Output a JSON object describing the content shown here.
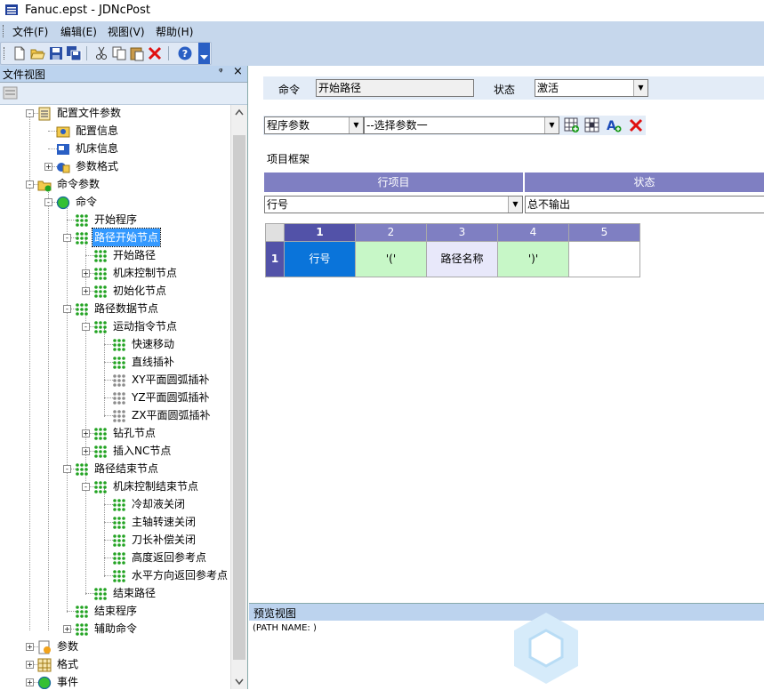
{
  "window": {
    "title": "Fanuc.epst - JDNcPost"
  },
  "menu": {
    "file": "文件(F)",
    "edit": "编辑(E)",
    "view": "视图(V)",
    "help": "帮助(H)"
  },
  "left_panel": {
    "title": "文件视图",
    "pin": "ᵠ",
    "close": "×"
  },
  "tree": [
    {
      "label": "配置文件参数",
      "icon": "config-file-icon"
    },
    {
      "label": "配置信息",
      "icon": "config-info-icon"
    },
    {
      "label": "机床信息",
      "icon": "machine-info-icon"
    },
    {
      "label": "参数格式",
      "icon": "param-format-icon"
    },
    {
      "label": "命令参数",
      "icon": "folder-icon"
    },
    {
      "label": "命令",
      "icon": "green-ball-icon"
    },
    {
      "label": "开始程序",
      "icon": "green-dots-icon"
    },
    {
      "label": "路径开始节点",
      "icon": "green-dots-icon",
      "selected": true
    },
    {
      "label": "开始路径",
      "icon": "green-dots-icon"
    },
    {
      "label": "机床控制节点",
      "icon": "green-dots-icon"
    },
    {
      "label": "初始化节点",
      "icon": "green-dots-icon"
    },
    {
      "label": "路径数据节点",
      "icon": "green-dots-icon"
    },
    {
      "label": "运动指令节点",
      "icon": "green-dots-icon"
    },
    {
      "label": "快速移动",
      "icon": "green-dots-icon"
    },
    {
      "label": "直线插补",
      "icon": "green-dots-icon"
    },
    {
      "label": "XY平面圆弧插补",
      "icon": "gray-dots-icon"
    },
    {
      "label": "YZ平面圆弧插补",
      "icon": "gray-dots-icon"
    },
    {
      "label": "ZX平面圆弧插补",
      "icon": "gray-dots-icon"
    },
    {
      "label": "钻孔节点",
      "icon": "green-dots-icon"
    },
    {
      "label": "插入NC节点",
      "icon": "green-dots-icon"
    },
    {
      "label": "路径结束节点",
      "icon": "green-dots-icon"
    },
    {
      "label": "机床控制结束节点",
      "icon": "green-dots-icon"
    },
    {
      "label": "冷却液关闭",
      "icon": "green-dots-icon"
    },
    {
      "label": "主轴转速关闭",
      "icon": "green-dots-icon"
    },
    {
      "label": "刀长补偿关闭",
      "icon": "green-dots-icon"
    },
    {
      "label": "高度返回参考点",
      "icon": "green-dots-icon"
    },
    {
      "label": "水平方向返回参考点",
      "icon": "green-dots-icon"
    },
    {
      "label": "结束路径",
      "icon": "green-dots-icon"
    },
    {
      "label": "结束程序",
      "icon": "green-dots-icon"
    },
    {
      "label": "辅助命令",
      "icon": "green-dots-icon"
    },
    {
      "label": "参数",
      "icon": "param-icon"
    },
    {
      "label": "格式",
      "icon": "format-icon"
    },
    {
      "label": "事件",
      "icon": "green-ball-icon"
    }
  ],
  "command_bar": {
    "command_label": "命令",
    "command_value": "开始路径",
    "status_label": "状态",
    "status_value": "激活"
  },
  "param_bar": {
    "program_param": "程序参数",
    "select_param": "--选择参数一"
  },
  "frame": {
    "title": "项目框架",
    "col_item": "行项目",
    "col_status": "状态",
    "item_value": "行号",
    "status_value": "总不输出"
  },
  "grid": {
    "col_headers": [
      "1",
      "2",
      "3",
      "4",
      "5"
    ],
    "row_header": "1",
    "cells": [
      "行号",
      "'('",
      "路径名称",
      "')'",
      ""
    ]
  },
  "preview": {
    "title": "预览视图",
    "content": "(PATH NAME: )"
  },
  "colors": {
    "grid_header": "#7f7fc2",
    "cell_selected": "#0a74da",
    "cell_green": "#c7f7c7",
    "cell_lavender": "#e8e8fa",
    "panel_header": "#bcd3ee"
  }
}
